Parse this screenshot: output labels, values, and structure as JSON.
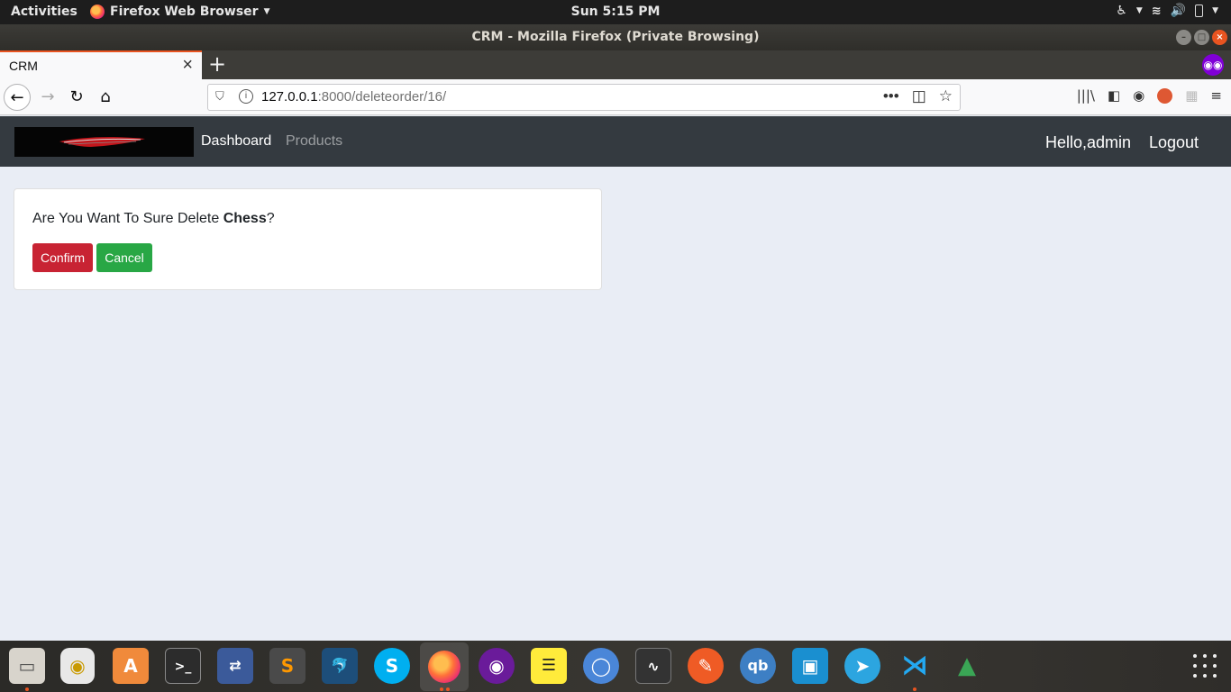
{
  "topbar": {
    "activities": "Activities",
    "app_menu": "Firefox Web Browser",
    "clock": "Sun  5:15 PM",
    "tray_icons": [
      "accessibility-icon",
      "wifi-icon",
      "volume-icon",
      "battery-icon",
      "power-menu-icon"
    ]
  },
  "window": {
    "title": "CRM - Mozilla Firefox (Private Browsing)"
  },
  "tab": {
    "title": "CRM",
    "close": "×",
    "new_tab": "+"
  },
  "urlbar": {
    "host": "127.0.0.1",
    "path": ":8000/deleteorder/16/"
  },
  "app_nav": {
    "dashboard": "Dashboard",
    "products": "Products",
    "hello": "Hello,admin",
    "logout": "Logout"
  },
  "confirm_card": {
    "message_prefix": "Are You Want To Sure Delete ",
    "item_name": "Chess",
    "message_suffix": "?",
    "confirm_label": "Confirm",
    "cancel_label": "Cancel"
  },
  "dock": {
    "apps": [
      "files-icon",
      "rhythmbox-icon",
      "software-center-icon",
      "terminal-icon",
      "network-icon",
      "sublime-text-icon",
      "mysql-workbench-icon",
      "skype-icon",
      "firefox-icon",
      "tor-browser-icon",
      "notes-icon",
      "chromium-icon",
      "system-monitor-icon",
      "postman-icon",
      "qbittorrent-icon",
      "remote-desktop-icon",
      "telegram-icon",
      "vscode-icon",
      "rocket-icon"
    ],
    "colors": {
      "confirm": "#c82333",
      "cancel": "#28a745",
      "navbar": "#343a40"
    }
  }
}
